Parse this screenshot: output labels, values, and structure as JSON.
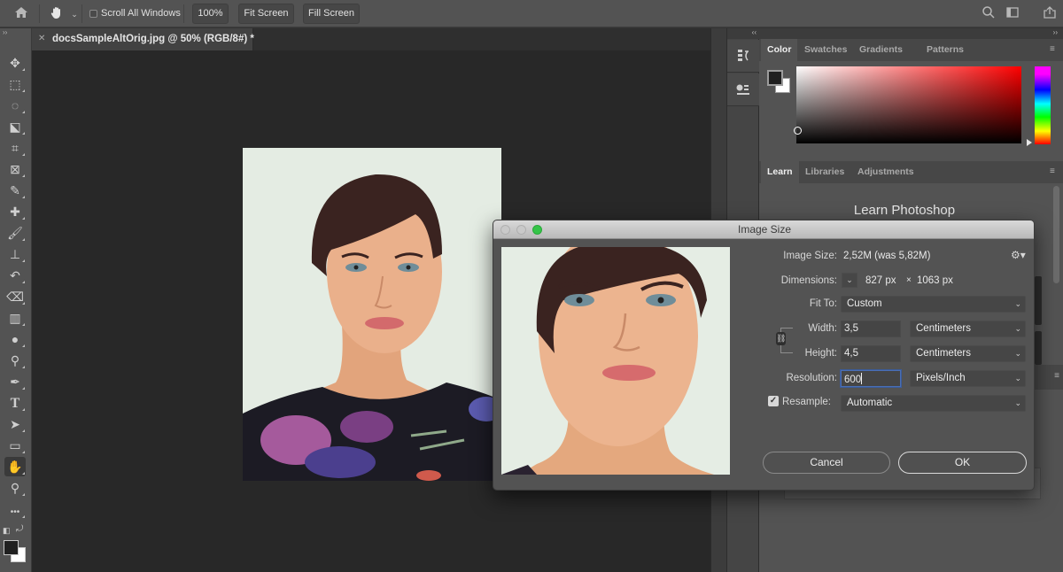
{
  "options_bar": {
    "home_icon": "home-icon",
    "hand_tool_icon": "hand-icon",
    "scroll_all_windows_label": "Scroll All Windows",
    "scroll_all_windows_checked": false,
    "zoom_100_label": "100%",
    "fit_screen_label": "Fit Screen",
    "fill_screen_label": "Fill Screen",
    "right_icons": [
      "search-icon",
      "workspace-icon",
      "share-icon"
    ]
  },
  "document_tab": {
    "title": "docsSampleAltOrig.jpg @ 50% (RGB/8#) *"
  },
  "toolbar": {
    "tools": [
      {
        "name": "move-tool",
        "glyph": "✥"
      },
      {
        "name": "marquee-tool",
        "glyph": "⬚"
      },
      {
        "name": "lasso-tool",
        "glyph": "◌"
      },
      {
        "name": "object-selection-tool",
        "glyph": "⬕"
      },
      {
        "name": "crop-tool",
        "glyph": "⌗"
      },
      {
        "name": "frame-tool",
        "glyph": "⊠"
      },
      {
        "name": "eyedropper-tool",
        "glyph": "✎"
      },
      {
        "name": "healing-brush-tool",
        "glyph": "✚"
      },
      {
        "name": "brush-tool",
        "glyph": "🖌"
      },
      {
        "name": "clone-stamp-tool",
        "glyph": "⊥"
      },
      {
        "name": "history-brush-tool",
        "glyph": "↶"
      },
      {
        "name": "eraser-tool",
        "glyph": "⌫"
      },
      {
        "name": "gradient-tool",
        "glyph": "▥"
      },
      {
        "name": "blur-tool",
        "glyph": "●"
      },
      {
        "name": "dodge-tool",
        "glyph": "⚲"
      },
      {
        "name": "pen-tool",
        "glyph": "✒"
      },
      {
        "name": "type-tool",
        "glyph": "T"
      },
      {
        "name": "path-selection-tool",
        "glyph": "➤"
      },
      {
        "name": "rectangle-tool",
        "glyph": "▭"
      },
      {
        "name": "hand-tool",
        "glyph": "✋"
      },
      {
        "name": "zoom-tool",
        "glyph": "⚲"
      },
      {
        "name": "edit-toolbar",
        "glyph": "•••"
      }
    ],
    "active_tool": "hand-tool",
    "foreground_color": "#202020",
    "background_color": "#ffffff"
  },
  "right_panels": {
    "color_panel": {
      "tabs": [
        "Color",
        "Swatches",
        "Gradients",
        "Patterns"
      ],
      "active_tab": "Color",
      "hue": "#ff0000"
    },
    "learn_panel": {
      "tabs": [
        "Learn",
        "Libraries",
        "Adjustments"
      ],
      "active_tab": "Learn",
      "heading": "Learn Photoshop"
    },
    "dock_icons": [
      "history-icon",
      "properties-icon"
    ]
  },
  "dialog": {
    "title": "Image Size",
    "image_size_label": "Image Size:",
    "image_size_value": "2,52M (was 5,82M)",
    "dimensions_label": "Dimensions:",
    "dimensions_width": "827 px",
    "dimensions_sep": "×",
    "dimensions_height": "1063 px",
    "fit_to_label": "Fit To:",
    "fit_to_value": "Custom",
    "width_label": "Width:",
    "width_value": "3,5",
    "width_unit": "Centimeters",
    "height_label": "Height:",
    "height_value": "4,5",
    "height_unit": "Centimeters",
    "resolution_label": "Resolution:",
    "resolution_value": "600",
    "resolution_unit": "Pixels/Inch",
    "resample_label": "Resample:",
    "resample_checked": true,
    "resample_value": "Automatic",
    "cancel_label": "Cancel",
    "ok_label": "OK"
  }
}
